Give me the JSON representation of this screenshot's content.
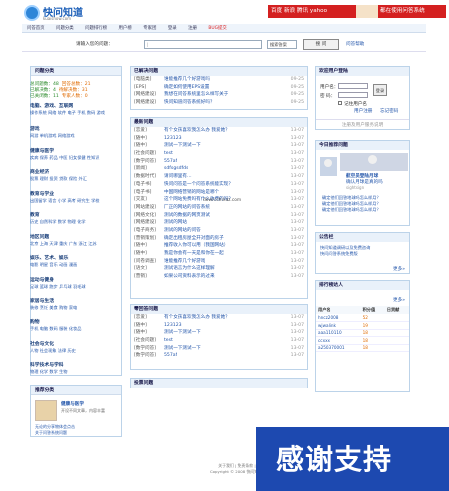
{
  "logo": {
    "name": "快问知道",
    "domain": "kuaishow.com"
  },
  "banner": {
    "text": "百度 新浪 腾讯 yahoo",
    "tagline": "都在使用问答系统"
  },
  "nav": [
    "问答首页",
    "问题分类",
    "问题排行榜",
    "用户榜",
    "专家团",
    "登录",
    "注册",
    "BUG提交"
  ],
  "search": {
    "label": "请输入您的问题：",
    "placeholder": "|",
    "select": "搜索答案",
    "button": "搜 问",
    "link": "问答帮助"
  },
  "left": {
    "title": "问题分类",
    "stats": [
      [
        "总问题数：48",
        "回答总数：21"
      ],
      [
        "已解决数：4",
        "待解决数：31"
      ],
      [
        "已关闭数：11",
        "专家人数：0"
      ]
    ],
    "categories": [
      {
        "title": "电脑、游戏、互联网",
        "sub": "操作系统 网络 软件 电子 手机 数码 游戏"
      },
      {
        "title": "游戏",
        "sub": "网游 单机游戏 网络游戏"
      },
      {
        "title": "健康与医学",
        "sub": "疾病 保养 药品 中医 妇女保健 性知识"
      },
      {
        "title": "商业经济",
        "sub": "股票 理财 投资 贷款 保险 外汇"
      },
      {
        "title": "教育与学业",
        "sub": "出国留学 语言 小学 高考 研究生 学校"
      },
      {
        "title": "教育",
        "sub": "历史 自然科学 数学 物理 化学"
      },
      {
        "title": "地区问题",
        "sub": "北京 上海 天津 重庆 广东 浙江 江苏"
      },
      {
        "title": "娱乐、艺术、娱乐",
        "sub": "电影 明星 音乐 动画 漫画"
      },
      {
        "title": "运动与健身",
        "sub": "足球 篮球 跑步 乒乓球 羽毛球"
      },
      {
        "title": "家居与生活",
        "sub": "装修 烹饪 美食 购物 家电"
      },
      {
        "title": "购物",
        "sub": "手机 电脑 数码 服装 化妆品"
      },
      {
        "title": "社会与文化",
        "sub": "人物 社会现象 法律 历史"
      },
      {
        "title": "科学技术与学科",
        "sub": "物理 化学 数学 生物"
      }
    ],
    "rec_title": "推荐分类",
    "rec_item": "健康与医学",
    "rec_desc": "开设不同文章，内容丰富",
    "rec_links": [
      "无论的分享物体会点击",
      "关于问答系统问题"
    ]
  },
  "mid": {
    "unsolved_title": "已解决问题",
    "unsolved": [
      {
        "c": "[电脑类]",
        "q": "谁能推荐几个好游戏吗",
        "d": "09-25"
      },
      {
        "c": "[EPS]",
        "q": "确定如何使用EPS设置",
        "d": "09-25"
      },
      {
        "c": "[网络建设]",
        "q": "我想在问答系统里怎么样写关于",
        "d": "09-25"
      },
      {
        "c": "[网络建设]",
        "q": "快问知道问答系统好吗？",
        "d": "09-25"
      }
    ],
    "new_title": "最新问题",
    "new": [
      {
        "c": "[恋爱]",
        "q": "有个女孩喜欢我怎么办 我爱她？",
        "d": "13-07"
      },
      {
        "c": "[随中]",
        "q": "123123",
        "d": "13-07"
      },
      {
        "c": "[随中]",
        "q": "测试一下测试一下",
        "d": "13-07"
      },
      {
        "c": "[社会问题]",
        "q": "test",
        "d": "13-07"
      },
      {
        "c": "[数学问答]",
        "q": "557af",
        "d": "13-07"
      },
      {
        "c": "[新闻]",
        "q": "sdfsgsdfds",
        "d": "13-07"
      },
      {
        "c": "[数据时代]",
        "q": "请问哪里有…",
        "d": "13-07"
      },
      {
        "c": "[电子书]",
        "q": "快问问答是一个问答系统能实现？",
        "d": "13-07"
      },
      {
        "c": "[电子书]",
        "q": "中国网络营销的网站是哪个",
        "d": "13-07"
      },
      {
        "c": "[交友]",
        "q": "这个网站免费吗有什么收费的吗？",
        "d": "13-07"
      },
      {
        "c": "[网站建设]",
        "q": "厂正的网站的问答系统",
        "d": "13-07"
      },
      {
        "c": "[网络文化]",
        "q": "测试的数据的网页测试",
        "d": "13-07"
      },
      {
        "c": "[网络建设]",
        "q": "测试的网站",
        "d": "13-07"
      },
      {
        "c": "[电子商务]",
        "q": "测试的网站的问答",
        "d": "13-07"
      },
      {
        "c": "[营销策划]",
        "q": "确定出租房屋全开对面的房子",
        "d": "13-07"
      },
      {
        "c": "[随中]",
        "q": "推荐收入你可以用（我国网站）",
        "d": "13-07"
      },
      {
        "c": "[随中]",
        "q": "我是你会有一天是和你在一起",
        "d": "13-07"
      },
      {
        "c": "[问卷调查]",
        "q": "谁能推荐几个好游戏",
        "d": "13-07"
      },
      {
        "c": "[语文]",
        "q": "测试语言为什么这样理解",
        "d": "13-07"
      },
      {
        "c": "[营销]",
        "q": "如果公司资料表示的过来",
        "d": "13-07"
      }
    ],
    "hot_title": "零回答问题",
    "hot": [
      {
        "c": "[恋爱]",
        "q": "有个女孩喜欢我怎么办 我爱她？",
        "d": "13-07"
      },
      {
        "c": "[随中]",
        "q": "123123",
        "d": "13-07"
      },
      {
        "c": "[随中]",
        "q": "测试一下测试一下",
        "d": "13-07"
      },
      {
        "c": "[社会问题]",
        "q": "test",
        "d": "13-07"
      },
      {
        "c": "[数学问答]",
        "q": "测试一下测试一下",
        "d": "13-07"
      },
      {
        "c": "[数学问答]",
        "q": "557af",
        "d": "13-07"
      }
    ],
    "vote_title": "投票问题"
  },
  "right": {
    "login_title": "欢迎用户登陆",
    "user_label": "用户名：",
    "pass_label": "密 码：",
    "login_btn": "登录",
    "remember": "记住用户名",
    "register": "用户注册",
    "forgot": "忘记密码",
    "help_link": "注册及用户服务说明",
    "rec_title": "今日推荐问题",
    "rec_caption": "航空员登陆月球",
    "rec_link": "确认月球是真的吗",
    "rec_src": "sightsign",
    "rec_list": [
      "确定他们回答地球吗怎么样月？",
      "确定他们回答地球吗怎么样月？",
      "确定他们回答地球吗怎么样月？"
    ],
    "notice_title": "公告栏",
    "notices": [
      "快问知道调研以及免费咨询",
      "快问问答系统免费版"
    ],
    "more": "更多»",
    "rank_title": "排行榜达人",
    "rank_cols": [
      "用户名",
      "积分值",
      "日贡献"
    ],
    "rank": [
      {
        "name": "hncz2008",
        "score": "52"
      },
      {
        "name": "wjwalink",
        "score": "19"
      },
      {
        "name": "aaa110110",
        "score": "18"
      },
      {
        "name": "ccxxx",
        "score": "18"
      },
      {
        "name": "a250370001",
        "score": "18"
      }
    ]
  },
  "footer": {
    "line1": "关于我们 | 免责条款 | 联系方式 | 使用协议",
    "line2": "Copyright © 2008 快问知道. All rights reserved"
  },
  "watermark": "down.chinaz.com",
  "overlay": "感谢支持"
}
